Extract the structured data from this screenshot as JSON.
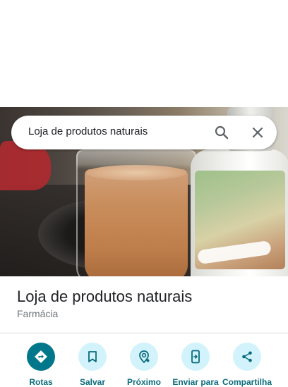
{
  "search": {
    "query": "Loja de produtos naturais",
    "search_icon": "search-icon",
    "close_icon": "close-icon"
  },
  "place": {
    "name": "Loja de produtos naturais",
    "category": "Farmácia",
    "photo": "photo"
  },
  "actions": [
    {
      "label": "Rotas",
      "icon": "directions-icon"
    },
    {
      "label": "Salvar",
      "icon": "bookmark-icon"
    },
    {
      "label": "Próximo",
      "icon": "nearby-icon"
    },
    {
      "label": "Enviar para",
      "icon": "send-to-phone-icon"
    },
    {
      "label": "Compartilha",
      "icon": "share-icon"
    }
  ],
  "colors": {
    "accent": "#00778a",
    "action_bg": "#d2f3fb",
    "action_text": "#0b6b7d",
    "title": "#202124",
    "secondary_text": "#70757a"
  }
}
